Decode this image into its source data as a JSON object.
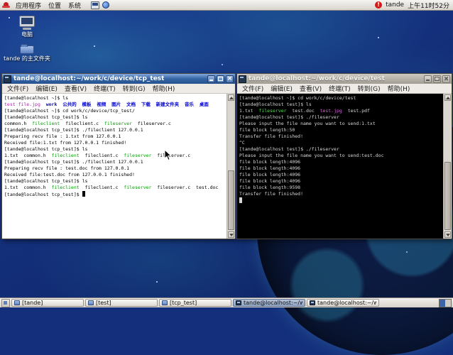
{
  "palette": {
    "green": "#00a000",
    "blue": "#0000d2",
    "magenta": "#b517b5",
    "dkfg": "#d6d6d6",
    "dkgreen": "#50e050",
    "dkmagenta": "#de62de",
    "titlebar_active": "#3465a4",
    "desktop_base": "#14307c"
  },
  "top_panel": {
    "menus": [
      "应用程序",
      "位置",
      "系统"
    ],
    "user": "tande",
    "clock": "上午11时52分"
  },
  "desktop": {
    "icons": [
      {
        "label": "电脑"
      },
      {
        "label": "tande 的主文件夹"
      }
    ]
  },
  "terminal_menu": [
    "文件(F)",
    "编辑(E)",
    "查看(V)",
    "终端(T)",
    "转到(G)",
    "帮助(H)"
  ],
  "windows": {
    "left": {
      "title": "tande@localhost:~/work/c/device/tcp_test",
      "lines": [
        [
          [
            "d",
            "[tande@localhost ~]$ ls"
          ]
        ],
        [
          [
            "m",
            "test file.jpg"
          ],
          [
            "d",
            "  "
          ],
          [
            "b",
            "work"
          ],
          [
            "d",
            "  "
          ],
          [
            "b",
            "公共的"
          ],
          [
            "d",
            "  "
          ],
          [
            "b",
            "模板"
          ],
          [
            "d",
            "  "
          ],
          [
            "b",
            "视频"
          ],
          [
            "d",
            "  "
          ],
          [
            "b",
            "图片"
          ],
          [
            "d",
            "  "
          ],
          [
            "b",
            "文档"
          ],
          [
            "d",
            "  "
          ],
          [
            "b",
            "下载"
          ],
          [
            "d",
            "  "
          ],
          [
            "b",
            "新建文件夹"
          ],
          [
            "d",
            "  "
          ],
          [
            "b",
            "音乐"
          ],
          [
            "d",
            "  "
          ],
          [
            "b",
            "桌面"
          ]
        ],
        [
          [
            "d",
            "[tande@localhost ~]$ cd work/c/device/tcp_test/"
          ]
        ],
        [
          [
            "d",
            "[tande@localhost tcp_test]$ ls"
          ]
        ],
        [
          [
            "d",
            "common.h  "
          ],
          [
            "g",
            "fileclient"
          ],
          [
            "d",
            "  fileclient.c  "
          ],
          [
            "g",
            "fileserver"
          ],
          [
            "d",
            "  fileserver.c"
          ]
        ],
        [
          [
            "d",
            "[tande@localhost tcp_test]$ ./fileclient 127.0.0.1"
          ]
        ],
        [
          [
            "d",
            "Preparing recv file : 1.txt from 127.0.0.1"
          ]
        ],
        [
          [
            "d",
            "Received file:1.txt from 127.0.0.1 finished!"
          ]
        ],
        [
          [
            "d",
            "[tande@localhost tcp_test]$ ls"
          ]
        ],
        [
          [
            "d",
            "1.txt  common.h  "
          ],
          [
            "g",
            "fileclient"
          ],
          [
            "d",
            "  fileclient.c  "
          ],
          [
            "g",
            "fileserver"
          ],
          [
            "d",
            "  fileserver.c"
          ]
        ],
        [
          [
            "d",
            "[tande@localhost tcp_test]$ ./fileclient 127.0.0.1"
          ]
        ],
        [
          [
            "d",
            "Preparing recv file : test.doc from 127.0.0.1"
          ]
        ],
        [
          [
            "d",
            "Received file:test.doc from 127.0.0.1 finished!"
          ]
        ],
        [
          [
            "d",
            "[tande@localhost tcp_test]$ ls"
          ]
        ],
        [
          [
            "d",
            "1.txt  common.h  "
          ],
          [
            "g",
            "fileclient"
          ],
          [
            "d",
            "  fileclient.c  "
          ],
          [
            "g",
            "fileserver"
          ],
          [
            "d",
            "  fileserver.c  test.doc"
          ]
        ],
        [
          [
            "d",
            "[tande@localhost tcp_test]$ "
          ],
          [
            "cur",
            ""
          ]
        ]
      ]
    },
    "right": {
      "title": "tande@localhost:~/work/c/device/test",
      "lines": [
        [
          [
            "d",
            "[tande@localhost ~]$ cd work/c/device/test"
          ]
        ],
        [
          [
            "d",
            "[tande@localhost test]$ ls"
          ]
        ],
        [
          [
            "d",
            "1.txt  "
          ],
          [
            "g",
            "fileserver"
          ],
          [
            "d",
            "  test.doc  "
          ],
          [
            "m",
            "test.jpg"
          ],
          [
            "d",
            "  test.pdf"
          ]
        ],
        [
          [
            "d",
            "[tande@localhost test]$ ./fileserver"
          ]
        ],
        [
          [
            "d",
            "Please input the file name you want to send:1.txt"
          ]
        ],
        [
          [
            "d",
            "file block length:50"
          ]
        ],
        [
          [
            "d",
            "Transfer file finished!"
          ]
        ],
        [
          [
            "d",
            "^C"
          ]
        ],
        [
          [
            "d",
            "[tande@localhost test]$ ./fileserver"
          ]
        ],
        [
          [
            "d",
            "Please input the file name you want to send:test.doc"
          ]
        ],
        [
          [
            "d",
            "file block length:4096"
          ]
        ],
        [
          [
            "d",
            "file block length:4096"
          ]
        ],
        [
          [
            "d",
            "file block length:4096"
          ]
        ],
        [
          [
            "d",
            "file block length:4096"
          ]
        ],
        [
          [
            "d",
            "file block length:9598"
          ]
        ],
        [
          [
            "d",
            "Transfer file finished!"
          ]
        ],
        [
          [
            "cur",
            ""
          ]
        ]
      ]
    }
  },
  "taskbar": {
    "buttons": [
      {
        "label": "[tande]",
        "icon": "folder",
        "active": false
      },
      {
        "label": "[test]",
        "icon": "folder",
        "active": false
      },
      {
        "label": "[tcp_test]",
        "icon": "folder",
        "active": false
      },
      {
        "label": "tande@localhost:~/work...",
        "icon": "terminal",
        "active": true
      },
      {
        "label": "tande@localhost:~/work",
        "icon": "terminal",
        "active": false
      }
    ]
  }
}
